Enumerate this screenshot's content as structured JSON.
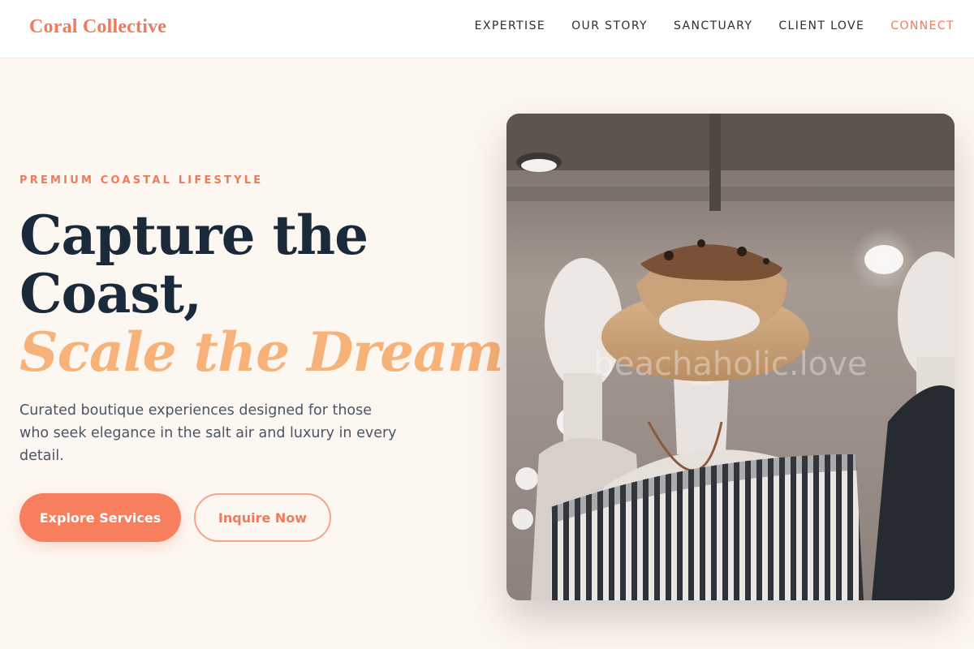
{
  "header": {
    "brand": "Coral Collective",
    "nav": [
      {
        "label": "EXPERTISE"
      },
      {
        "label": "OUR STORY"
      },
      {
        "label": "SANCTUARY"
      },
      {
        "label": "CLIENT LOVE"
      },
      {
        "label": "CONNECT"
      }
    ]
  },
  "hero": {
    "eyebrow": "PREMIUM COASTAL LIFESTYLE",
    "headline_line1": "Capture the",
    "headline_line2": "Coast,",
    "headline_accent": "Scale the Dream.",
    "lede": "Curated boutique experiences designed for those who seek elegance in the salt air and luxury in every detail.",
    "primary_cta": "Explore Services",
    "secondary_cta": "Inquire Now",
    "image_watermark": "beachaholic.love"
  },
  "colors": {
    "accent": "#f07a5a",
    "accent_soft": "#f7b27a",
    "ink": "#1b2a3b",
    "page_bg": "#fdf7f2"
  }
}
